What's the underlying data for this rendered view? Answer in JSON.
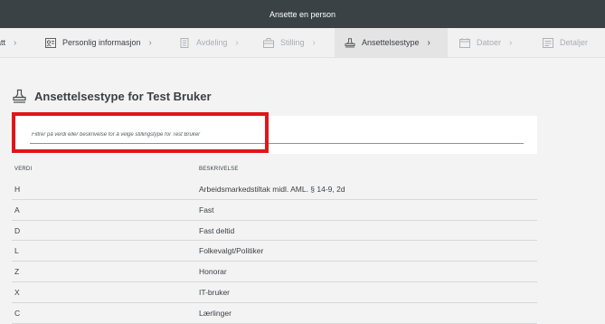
{
  "window": {
    "title": "Ansette en person"
  },
  "steps": [
    {
      "label": "att",
      "state": "done"
    },
    {
      "label": "Personlig informasjon",
      "state": "done"
    },
    {
      "label": "Avdeling",
      "state": "disabled"
    },
    {
      "label": "Stilling",
      "state": "disabled"
    },
    {
      "label": "Ansettelsestype",
      "state": "active"
    },
    {
      "label": "Datoer",
      "state": "disabled"
    },
    {
      "label": "Detaljer",
      "state": "disabled"
    }
  ],
  "page": {
    "heading": "Ansettelsestype for Test Bruker"
  },
  "filter": {
    "placeholder": "Filtrer på verdi eller beskrivelse for å velge stillingstype for Test Bruker",
    "value": ""
  },
  "table": {
    "columns": {
      "value": "VERDI",
      "description": "BESKRIVELSE"
    },
    "rows": [
      {
        "value": "H",
        "description": "Arbeidsmarkedstiltak midl. AML. § 14-9, 2d"
      },
      {
        "value": "A",
        "description": "Fast"
      },
      {
        "value": "D",
        "description": "Fast deltid"
      },
      {
        "value": "L",
        "description": "Folkevalgt/Politiker"
      },
      {
        "value": "Z",
        "description": "Honorar"
      },
      {
        "value": "X",
        "description": "IT-bruker"
      },
      {
        "value": "C",
        "description": "Lærlinger"
      }
    ]
  },
  "colors": {
    "topbar": "#3a4245",
    "highlight": "#e0161b",
    "text": "#3b4146"
  }
}
